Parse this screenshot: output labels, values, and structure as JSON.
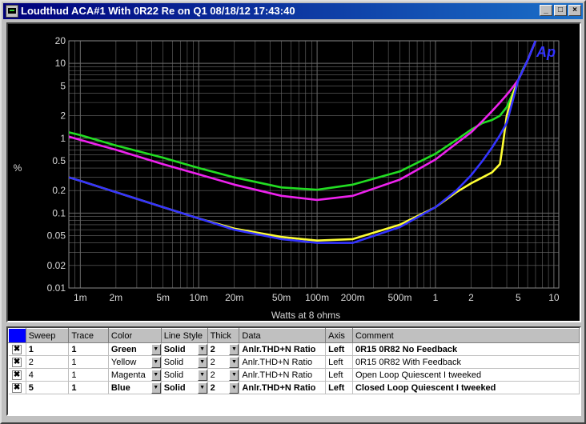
{
  "window": {
    "title": "Loudthud  ACA#1 With 0R22 Re on Q1  08/18/12 17:43:40",
    "minimize": "_",
    "maximize": "□",
    "close": "×"
  },
  "chart_data": {
    "type": "line",
    "xlabel": "Watts at 8 ohms",
    "ylabel": "%",
    "x_scale": "log",
    "y_scale": "log",
    "xlim": [
      0.0008,
      11
    ],
    "ylim": [
      0.01,
      20
    ],
    "grid": true,
    "badge": "Ap",
    "x_ticks": [
      {
        "v": 0.001,
        "label": "1m"
      },
      {
        "v": 0.002,
        "label": "2m"
      },
      {
        "v": 0.005,
        "label": "5m"
      },
      {
        "v": 0.01,
        "label": "10m"
      },
      {
        "v": 0.02,
        "label": "20m"
      },
      {
        "v": 0.05,
        "label": "50m"
      },
      {
        "v": 0.1,
        "label": "100m"
      },
      {
        "v": 0.2,
        "label": "200m"
      },
      {
        "v": 0.5,
        "label": "500m"
      },
      {
        "v": 1,
        "label": "1"
      },
      {
        "v": 2,
        "label": "2"
      },
      {
        "v": 5,
        "label": "5"
      },
      {
        "v": 10,
        "label": "10"
      }
    ],
    "y_ticks": [
      {
        "v": 20,
        "label": "20"
      },
      {
        "v": 10,
        "label": "10"
      },
      {
        "v": 5,
        "label": "5"
      },
      {
        "v": 2,
        "label": "2"
      },
      {
        "v": 1,
        "label": "1"
      },
      {
        "v": 0.5,
        "label": "0.5"
      },
      {
        "v": 0.2,
        "label": "0.2"
      },
      {
        "v": 0.1,
        "label": "0.1"
      },
      {
        "v": 0.05,
        "label": "0.05"
      },
      {
        "v": 0.02,
        "label": "0.02"
      },
      {
        "v": 0.01,
        "label": "0.01"
      }
    ],
    "series": [
      {
        "color": "#22dd22",
        "points": [
          [
            0.0008,
            1.2
          ],
          [
            0.001,
            1.1
          ],
          [
            0.002,
            0.8
          ],
          [
            0.005,
            0.55
          ],
          [
            0.01,
            0.4
          ],
          [
            0.02,
            0.3
          ],
          [
            0.05,
            0.22
          ],
          [
            0.1,
            0.205
          ],
          [
            0.2,
            0.24
          ],
          [
            0.5,
            0.36
          ],
          [
            1,
            0.62
          ],
          [
            1.5,
            0.95
          ],
          [
            2,
            1.3
          ],
          [
            2.5,
            1.6
          ],
          [
            3,
            1.75
          ],
          [
            3.5,
            2.0
          ],
          [
            4,
            2.6
          ],
          [
            4.5,
            4.0
          ],
          [
            5,
            6.0
          ],
          [
            5.5,
            8.5
          ],
          [
            6,
            11
          ],
          [
            7,
            20
          ]
        ]
      },
      {
        "color": "#ffff33",
        "points": [
          [
            0.0008,
            0.3
          ],
          [
            0.001,
            0.27
          ],
          [
            0.002,
            0.19
          ],
          [
            0.005,
            0.12
          ],
          [
            0.01,
            0.085
          ],
          [
            0.02,
            0.062
          ],
          [
            0.05,
            0.048
          ],
          [
            0.1,
            0.043
          ],
          [
            0.2,
            0.045
          ],
          [
            0.5,
            0.07
          ],
          [
            1,
            0.12
          ],
          [
            1.5,
            0.19
          ],
          [
            2,
            0.25
          ],
          [
            2.5,
            0.3
          ],
          [
            3,
            0.35
          ],
          [
            3.5,
            0.45
          ],
          [
            3.7,
            0.8
          ],
          [
            4,
            2.0
          ],
          [
            4.5,
            3.8
          ],
          [
            5,
            6.0
          ],
          [
            6,
            11
          ],
          [
            7,
            20
          ]
        ]
      },
      {
        "color": "#ee22ee",
        "points": [
          [
            0.0008,
            1.05
          ],
          [
            0.001,
            0.95
          ],
          [
            0.002,
            0.7
          ],
          [
            0.005,
            0.45
          ],
          [
            0.01,
            0.33
          ],
          [
            0.02,
            0.24
          ],
          [
            0.05,
            0.17
          ],
          [
            0.1,
            0.15
          ],
          [
            0.2,
            0.17
          ],
          [
            0.5,
            0.28
          ],
          [
            1,
            0.52
          ],
          [
            1.5,
            0.85
          ],
          [
            2,
            1.2
          ],
          [
            2.5,
            1.7
          ],
          [
            3,
            2.3
          ],
          [
            3.5,
            3.0
          ],
          [
            4,
            3.8
          ],
          [
            4.5,
            4.8
          ],
          [
            5,
            6.0
          ],
          [
            6,
            11
          ],
          [
            7,
            20
          ]
        ]
      },
      {
        "color": "#3333ff",
        "points": [
          [
            0.0008,
            0.3
          ],
          [
            0.001,
            0.27
          ],
          [
            0.002,
            0.19
          ],
          [
            0.005,
            0.12
          ],
          [
            0.01,
            0.085
          ],
          [
            0.02,
            0.06
          ],
          [
            0.05,
            0.045
          ],
          [
            0.1,
            0.04
          ],
          [
            0.2,
            0.04
          ],
          [
            0.5,
            0.065
          ],
          [
            1,
            0.12
          ],
          [
            1.5,
            0.2
          ],
          [
            2,
            0.32
          ],
          [
            2.5,
            0.5
          ],
          [
            3,
            0.75
          ],
          [
            3.5,
            1.1
          ],
          [
            4,
            1.6
          ],
          [
            4.5,
            3.2
          ],
          [
            5,
            6.0
          ],
          [
            6,
            11
          ],
          [
            7,
            20
          ]
        ]
      }
    ]
  },
  "table": {
    "headers": [
      "",
      "Sweep",
      "Trace",
      "Color",
      "Line Style",
      "Thick",
      "Data",
      "Axis",
      "Comment"
    ],
    "rows": [
      {
        "checked": "✖",
        "sweep": "1",
        "trace": "1",
        "color": "Green",
        "style": "Solid",
        "thick": "2",
        "data": "Anlr.THD+N Ratio",
        "axis": "Left",
        "comment": "0R15 0R82 No Feedback",
        "bold": true
      },
      {
        "checked": "✖",
        "sweep": "2",
        "trace": "1",
        "color": "Yellow",
        "style": "Solid",
        "thick": "2",
        "data": "Anlr.THD+N Ratio",
        "axis": "Left",
        "comment": "0R15 0R82 With Feedback",
        "bold": false
      },
      {
        "checked": "✖",
        "sweep": "4",
        "trace": "1",
        "color": "Magenta",
        "style": "Solid",
        "thick": "2",
        "data": "Anlr.THD+N Ratio",
        "axis": "Left",
        "comment": "Open Loop Quiescent I tweeked",
        "bold": false
      },
      {
        "checked": "✖",
        "sweep": "5",
        "trace": "1",
        "color": "Blue",
        "style": "Solid",
        "thick": "2",
        "data": "Anlr.THD+N Ratio",
        "axis": "Left",
        "comment": "Closed Loop Quiescent I tweeked",
        "bold": true
      }
    ]
  }
}
